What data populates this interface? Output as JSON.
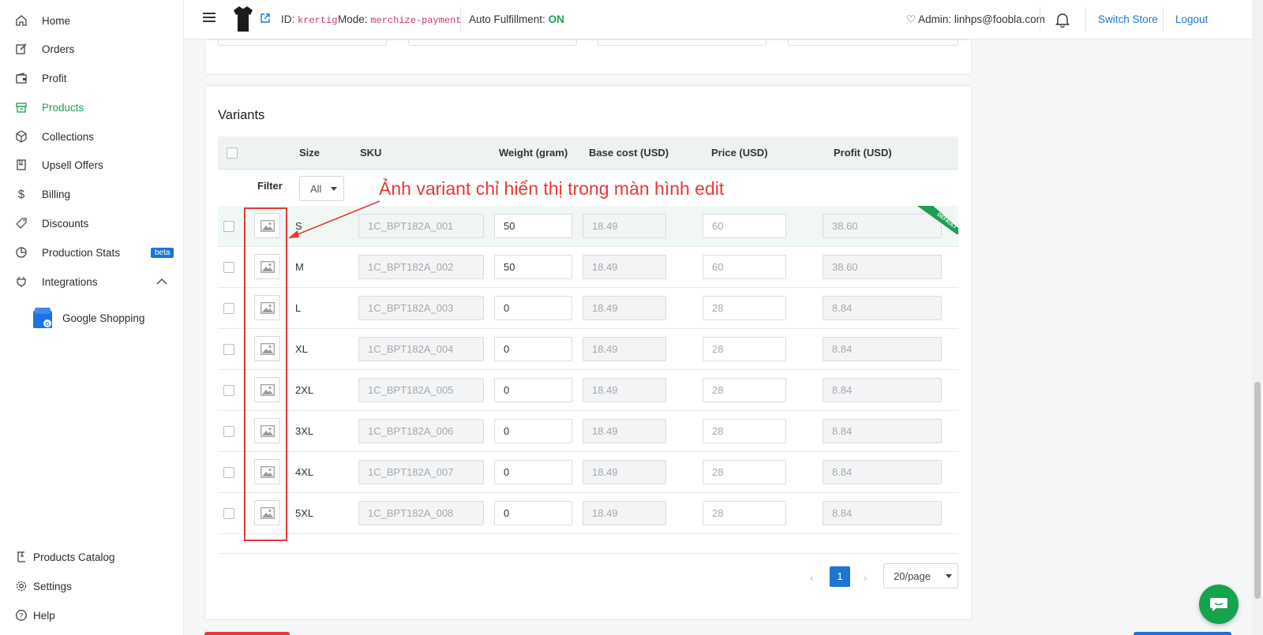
{
  "sidebar": {
    "items": [
      {
        "label": "Home",
        "icon": "home-icon"
      },
      {
        "label": "Orders",
        "icon": "edit-icon"
      },
      {
        "label": "Profit",
        "icon": "wallet-icon"
      },
      {
        "label": "Products",
        "icon": "box-icon",
        "active": true
      },
      {
        "label": "Collections",
        "icon": "cube-icon"
      },
      {
        "label": "Upsell Offers",
        "icon": "book-icon"
      },
      {
        "label": "Billing",
        "icon": "dollar-icon"
      },
      {
        "label": "Discounts",
        "icon": "tag-icon"
      },
      {
        "label": "Production Stats",
        "icon": "pie-chart-icon",
        "badge": "beta"
      },
      {
        "label": "Integrations",
        "icon": "plug-icon"
      }
    ],
    "sub_item": {
      "label": "Google Shopping"
    },
    "bottom": [
      {
        "label": "Products Catalog",
        "icon": "catalog-icon"
      },
      {
        "label": "Settings",
        "icon": "gear-icon"
      },
      {
        "label": "Help",
        "icon": "help-icon"
      }
    ]
  },
  "header": {
    "id_label": "ID:",
    "id_value": "krertig",
    "mode_label": "Mode:",
    "mode_value": "merchize-payment",
    "auto_label": "Auto Fulfillment:",
    "auto_value": "ON",
    "admin": "Admin: linhps@foobla.com",
    "switch_store": "Switch Store",
    "logout": "Logout"
  },
  "variants": {
    "title": "Variants",
    "columns": [
      "Size",
      "SKU",
      "Weight (gram)",
      "Base cost (USD)",
      "Price (USD)",
      "Profit (USD)"
    ],
    "filter_label": "Filter",
    "filter_value": "All",
    "default_ribbon": "DEFAULT",
    "rows": [
      {
        "size": "S",
        "sku": "1C_BPT182A_001",
        "weight": "50",
        "base_cost": "18.49",
        "price": "60",
        "profit": "38.60"
      },
      {
        "size": "M",
        "sku": "1C_BPT182A_002",
        "weight": "50",
        "base_cost": "18.49",
        "price": "60",
        "profit": "38.60"
      },
      {
        "size": "L",
        "sku": "1C_BPT182A_003",
        "weight": "0",
        "base_cost": "18.49",
        "price": "28",
        "profit": "8.84"
      },
      {
        "size": "XL",
        "sku": "1C_BPT182A_004",
        "weight": "0",
        "base_cost": "18.49",
        "price": "28",
        "profit": "8.84"
      },
      {
        "size": "2XL",
        "sku": "1C_BPT182A_005",
        "weight": "0",
        "base_cost": "18.49",
        "price": "28",
        "profit": "8.84"
      },
      {
        "size": "3XL",
        "sku": "1C_BPT182A_006",
        "weight": "0",
        "base_cost": "18.49",
        "price": "28",
        "profit": "8.84"
      },
      {
        "size": "4XL",
        "sku": "1C_BPT182A_007",
        "weight": "0",
        "base_cost": "18.49",
        "price": "28",
        "profit": "8.84"
      },
      {
        "size": "5XL",
        "sku": "1C_BPT182A_008",
        "weight": "0",
        "base_cost": "18.49",
        "price": "28",
        "profit": "8.84"
      }
    ]
  },
  "pagination": {
    "prev": "‹",
    "current": "1",
    "next": "›",
    "per_page": "20/page"
  },
  "annotation": {
    "text": "Ảnh variant chỉ hiển thị trong màn hình edit",
    "color": "#e53935"
  },
  "colors": {
    "accent": "#1f9d55",
    "link": "#1976d2",
    "annotation": "#e53935"
  }
}
